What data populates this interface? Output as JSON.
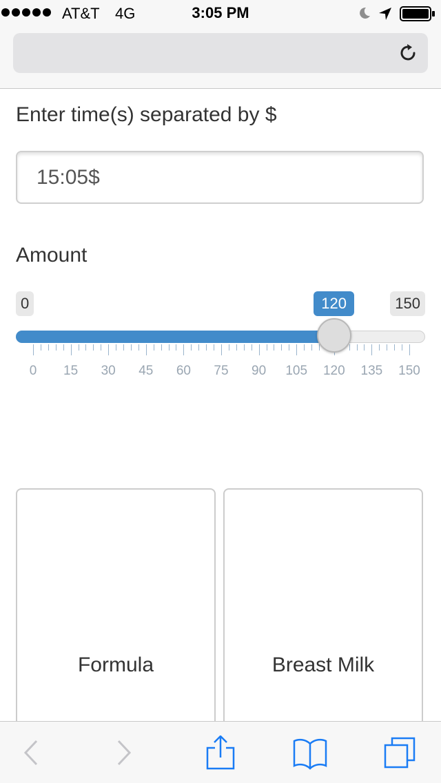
{
  "status_bar": {
    "carrier": "AT&T",
    "network": "4G",
    "time": "3:05 PM",
    "icons": [
      "signal-dots-icon",
      "moon-icon",
      "location-arrow-icon",
      "battery-full-icon"
    ]
  },
  "browser": {
    "url": "",
    "reload_icon": "reload-icon"
  },
  "form": {
    "time_label": "Enter time(s) separated by $",
    "time_value": "15:05$",
    "amount_label": "Amount",
    "slider": {
      "min": 0,
      "max": 150,
      "value": 120,
      "min_label": "0",
      "max_label": "150",
      "value_label": "120",
      "tick_labels": [
        "0",
        "15",
        "30",
        "45",
        "60",
        "75",
        "90",
        "105",
        "120",
        "135",
        "150"
      ]
    }
  },
  "choices": {
    "formula": "Formula",
    "breast_milk": "Breast Milk"
  },
  "toolbar": {
    "icons": [
      "back-icon",
      "forward-icon",
      "share-icon",
      "bookmarks-icon",
      "tabs-icon"
    ]
  },
  "colors": {
    "accent": "#428bca",
    "ios_blue": "#1a7cf5"
  }
}
